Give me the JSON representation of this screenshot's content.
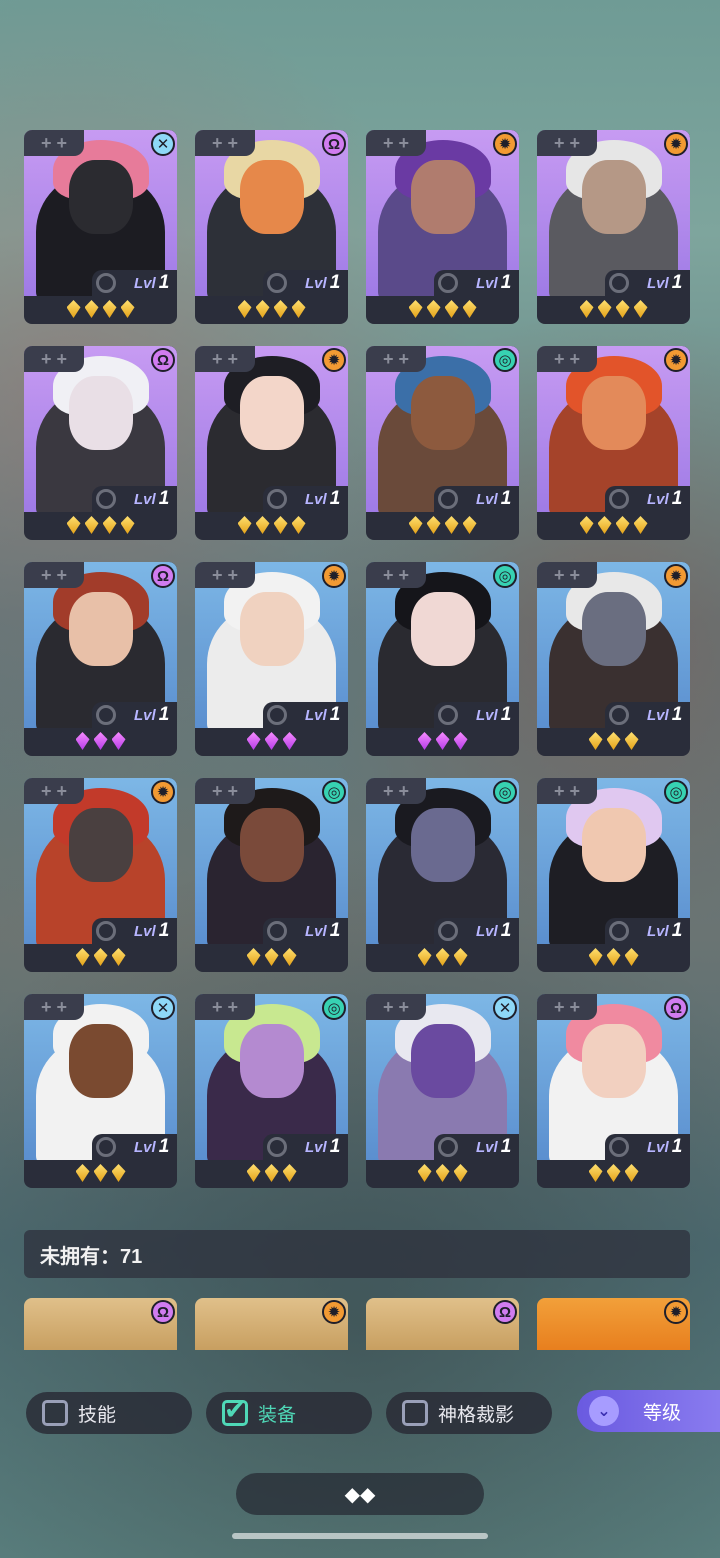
{
  "tab_plus_label": "+ +",
  "lvl_prefix": "Lvl",
  "owned_heroes": [
    {
      "bg": "purple",
      "class_icon": "cross-icon",
      "class_color": "cyan",
      "level": "1",
      "stars": 4,
      "star_color": "gold",
      "skin": "#2b2b30",
      "hair": "#e77b9a",
      "figure": "#1c1c22"
    },
    {
      "bg": "purple",
      "class_icon": "omega-icon",
      "class_color": "purple",
      "level": "1",
      "stars": 4,
      "star_color": "gold",
      "skin": "#e6884a",
      "hair": "#e8d7a4",
      "figure": "#2d3038"
    },
    {
      "bg": "purple",
      "class_icon": "sun-icon",
      "class_color": "orange",
      "level": "1",
      "stars": 4,
      "star_color": "gold",
      "skin": "#b07c6e",
      "hair": "#6a3aa3",
      "figure": "#5a4a8a"
    },
    {
      "bg": "purple",
      "class_icon": "sun-icon",
      "class_color": "orange",
      "level": "1",
      "stars": 4,
      "star_color": "gold",
      "skin": "#b59886",
      "hair": "#e6e6e6",
      "figure": "#5a5a60"
    },
    {
      "bg": "purple",
      "class_icon": "omega-icon",
      "class_color": "purple",
      "level": "1",
      "stars": 4,
      "star_color": "gold",
      "skin": "#e9dfe6",
      "hair": "#f0f0f5",
      "figure": "#3a3840"
    },
    {
      "bg": "purple",
      "class_icon": "sun-icon",
      "class_color": "orange",
      "level": "1",
      "stars": 4,
      "star_color": "gold",
      "skin": "#f3d6c9",
      "hair": "#1e1e24",
      "figure": "#2b2b30"
    },
    {
      "bg": "purple",
      "class_icon": "spiral-icon",
      "class_color": "teal",
      "level": "1",
      "stars": 4,
      "star_color": "gold",
      "skin": "#8d5a3e",
      "hair": "#3b6fa8",
      "figure": "#6a4a3a"
    },
    {
      "bg": "purple",
      "class_icon": "sun-icon",
      "class_color": "orange",
      "level": "1",
      "stars": 4,
      "star_color": "gold",
      "skin": "#e38a5a",
      "hair": "#e2542a",
      "figure": "#a5432a"
    },
    {
      "bg": "blue",
      "class_icon": "omega-icon",
      "class_color": "purple",
      "level": "1",
      "stars": 3,
      "star_color": "pink",
      "skin": "#e8c0a8",
      "hair": "#a23c2a",
      "figure": "#2a2a30"
    },
    {
      "bg": "blue",
      "class_icon": "sun-icon",
      "class_color": "orange",
      "level": "1",
      "stars": 3,
      "star_color": "pink",
      "skin": "#f0d2c0",
      "hair": "#f2f2f2",
      "figure": "#ececec"
    },
    {
      "bg": "blue",
      "class_icon": "spiral-icon",
      "class_color": "teal",
      "level": "1",
      "stars": 3,
      "star_color": "pink",
      "skin": "#f0d8d4",
      "hair": "#15151a",
      "figure": "#2a2a30"
    },
    {
      "bg": "blue",
      "class_icon": "sun-icon",
      "class_color": "orange",
      "level": "1",
      "stars": 3,
      "star_color": "gold",
      "skin": "#6a6e80",
      "hair": "#e8e8e8",
      "figure": "#3a3030"
    },
    {
      "bg": "blue",
      "class_icon": "sun-icon",
      "class_color": "orange",
      "level": "1",
      "stars": 3,
      "star_color": "gold",
      "skin": "#4a4040",
      "hair": "#c23a2a",
      "figure": "#b8432a"
    },
    {
      "bg": "blue",
      "class_icon": "spiral-icon",
      "class_color": "teal",
      "level": "1",
      "stars": 3,
      "star_color": "gold",
      "skin": "#7a4a3a",
      "hair": "#1e1a1a",
      "figure": "#2a2430"
    },
    {
      "bg": "blue",
      "class_icon": "spiral-icon",
      "class_color": "teal",
      "level": "1",
      "stars": 3,
      "star_color": "gold",
      "skin": "#6a6a90",
      "hair": "#1a1a20",
      "figure": "#2a2a34"
    },
    {
      "bg": "blue",
      "class_icon": "spiral-icon",
      "class_color": "teal",
      "level": "1",
      "stars": 3,
      "star_color": "gold",
      "skin": "#f0c8b0",
      "hair": "#e0c8f0",
      "figure": "#1e1e24"
    },
    {
      "bg": "blue",
      "class_icon": "cross-icon",
      "class_color": "cyan",
      "level": "1",
      "stars": 3,
      "star_color": "gold",
      "skin": "#7a4a30",
      "hair": "#f2f2f2",
      "figure": "#f2f2f2"
    },
    {
      "bg": "blue",
      "class_icon": "spiral-icon",
      "class_color": "teal",
      "level": "1",
      "stars": 3,
      "star_color": "gold",
      "skin": "#b48ad0",
      "hair": "#c8e890",
      "figure": "#3a2a4a"
    },
    {
      "bg": "blue",
      "class_icon": "cross-icon",
      "class_color": "cyan",
      "level": "1",
      "stars": 3,
      "star_color": "gold",
      "skin": "#6a4aa0",
      "hair": "#e8e8f0",
      "figure": "#8a7ab0"
    },
    {
      "bg": "blue",
      "class_icon": "omega-icon",
      "class_color": "purple",
      "level": "1",
      "stars": 3,
      "star_color": "gold",
      "skin": "#f2d0c0",
      "hair": "#f08aa0",
      "figure": "#f2f2f2"
    }
  ],
  "unowned_label": "未拥有：71",
  "unowned_heroes": [
    {
      "bg": "gold",
      "class_icon": "omega-icon",
      "class_color": "purple"
    },
    {
      "bg": "gold",
      "class_icon": "sun-icon",
      "class_color": "orange"
    },
    {
      "bg": "gold",
      "class_icon": "omega-icon",
      "class_color": "purple"
    },
    {
      "bg": "sun",
      "class_icon": "sun-icon",
      "class_color": "orange"
    }
  ],
  "filters": [
    {
      "label": "技能",
      "checked": false
    },
    {
      "label": "装备",
      "checked": true
    },
    {
      "label": "神格裁影",
      "checked": false
    }
  ],
  "sort_button": {
    "label": "等级",
    "icon": "double-chevron-down-icon"
  },
  "collapse_icon": "collapse-icon",
  "colors": {
    "accent": "#4fd8b7",
    "sort_button": "#7a6ce8"
  }
}
